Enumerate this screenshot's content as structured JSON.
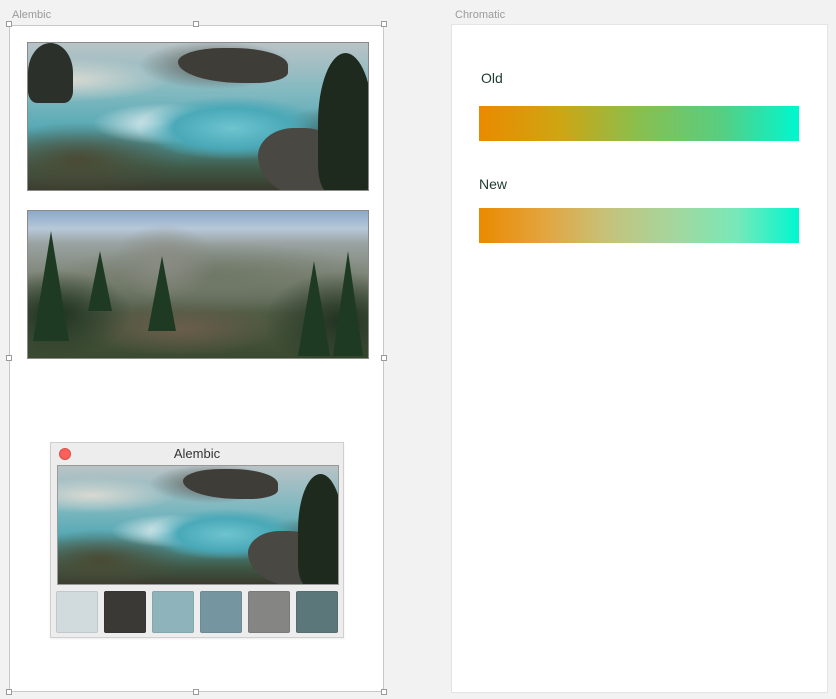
{
  "artboards": {
    "left_label": "Alembic",
    "right_label": "Chromatic"
  },
  "app_window": {
    "title": "Alembic",
    "swatches": [
      "#d1dadd",
      "#3b3936",
      "#8fb3bb",
      "#7596a0",
      "#858583",
      "#5c777a"
    ]
  },
  "chromatic": {
    "old_label": "Old",
    "new_label": "New",
    "old_gradient": [
      "#ea8a00",
      "#cfa512",
      "#88bf4f",
      "#59cd7f",
      "#00f7d0"
    ],
    "new_gradient": [
      "#ea8a00",
      "#e4a43e",
      "#c6c27b",
      "#a6d59c",
      "#7ae8b8",
      "#00f7d0"
    ]
  }
}
